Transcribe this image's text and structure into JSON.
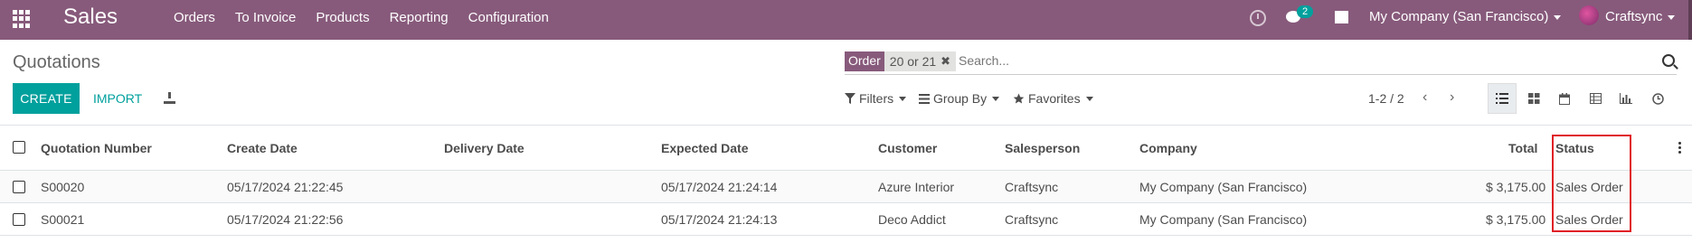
{
  "navbar": {
    "app_name": "Sales",
    "menu": [
      "Orders",
      "To Invoice",
      "Products",
      "Reporting",
      "Configuration"
    ],
    "chat_count": "2",
    "company": "My Company (San Francisco)",
    "user": "Craftsync",
    "color": "#875a7b"
  },
  "page": {
    "title": "Quotations",
    "create_label": "CREATE",
    "import_label": "IMPORT"
  },
  "search": {
    "facet_label": "Order",
    "facet_values": "20 or 21",
    "placeholder": "Search..."
  },
  "controls": {
    "filters": "Filters",
    "group_by": "Group By",
    "favorites": "Favorites",
    "pager": "1-2 / 2"
  },
  "table": {
    "columns": {
      "number": "Quotation Number",
      "create_date": "Create Date",
      "delivery_date": "Delivery Date",
      "expected_date": "Expected Date",
      "customer": "Customer",
      "salesperson": "Salesperson",
      "company": "Company",
      "total": "Total",
      "status": "Status"
    },
    "rows": [
      {
        "number": "S00020",
        "create_date": "05/17/2024 21:22:45",
        "delivery_date": "",
        "expected_date": "05/17/2024 21:24:14",
        "customer": "Azure Interior",
        "salesperson": "Craftsync",
        "company": "My Company (San Francisco)",
        "total": "$ 3,175.00",
        "status": "Sales Order"
      },
      {
        "number": "S00021",
        "create_date": "05/17/2024 21:22:56",
        "delivery_date": "",
        "expected_date": "05/17/2024 21:24:13",
        "customer": "Deco Addict",
        "salesperson": "Craftsync",
        "company": "My Company (San Francisco)",
        "total": "$ 3,175.00",
        "status": "Sales Order"
      }
    ]
  },
  "icons": {
    "apps": "apps-grid-icon",
    "clock": "clock-icon",
    "chat": "chat-icon",
    "gift": "gift-icon",
    "search": "search-icon",
    "download": "download-icon",
    "views": [
      "list-view-icon",
      "kanban-view-icon",
      "calendar-view-icon",
      "pivot-view-icon",
      "graph-view-icon",
      "activity-view-icon"
    ]
  },
  "colors": {
    "accent": "#00a09d",
    "highlight": "#e01f25"
  }
}
